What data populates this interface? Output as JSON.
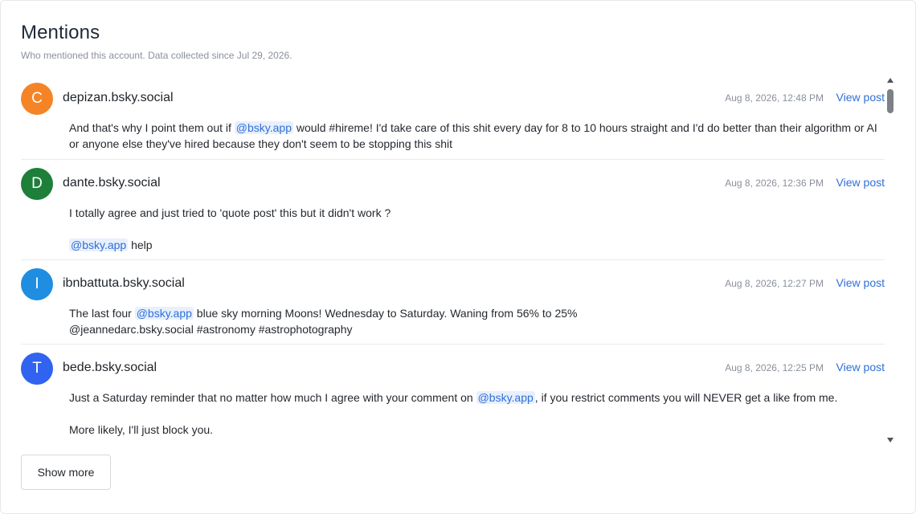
{
  "header": {
    "title": "Mentions",
    "subtitle": "Who mentioned this account. Data collected since Jul 29, 2026."
  },
  "mentions": [
    {
      "avatar_letter": "C",
      "avatar_color": "#f58426",
      "handle": "depizan.bsky.social",
      "timestamp": "Aug 8, 2026, 12:48 PM",
      "link_label": "View post",
      "text_before": "And that's why I point them out if ",
      "mention": "@bsky.app",
      "text_after": " would #hireme! I'd take care of this shit every day for 8 to 10 hours straight and I'd do better than their algorithm or AI or anyone else they've hired because they don't seem to be stopping this shit"
    },
    {
      "avatar_letter": "D",
      "avatar_color": "#1d7f3a",
      "handle": "dante.bsky.social",
      "timestamp": "Aug 8, 2026, 12:36 PM",
      "link_label": "View post",
      "line1": "I totally agree and just tried to 'quote post' this but it didn't work ?",
      "mention": "@bsky.app",
      "text_after": " help"
    },
    {
      "avatar_letter": "I",
      "avatar_color": "#1f8ee0",
      "handle": "ibnbattuta.bsky.social",
      "timestamp": "Aug 8, 2026, 12:27 PM",
      "link_label": "View post",
      "text_before": "The last four ",
      "mention": "@bsky.app",
      "text_after": " blue sky morning Moons! Wednesday to Saturday. Waning from 56% to 25%",
      "line2": "@jeannedarc.bsky.social #astronomy #astrophotography"
    },
    {
      "avatar_letter": "T",
      "avatar_color": "#2f63f0",
      "handle": "bede.bsky.social",
      "timestamp": "Aug 8, 2026, 12:25 PM",
      "link_label": "View post",
      "text_before": "Just a Saturday reminder that no matter how much I agree with your comment on ",
      "mention": "@bsky.app",
      "text_after": ", if you restrict comments you will NEVER get a like from me.",
      "line2": "More likely, I'll just block you."
    }
  ],
  "footer": {
    "show_more_label": "Show more"
  },
  "colors": {
    "link": "#2f6fd8",
    "mention_bg": "#e8f0fd"
  }
}
